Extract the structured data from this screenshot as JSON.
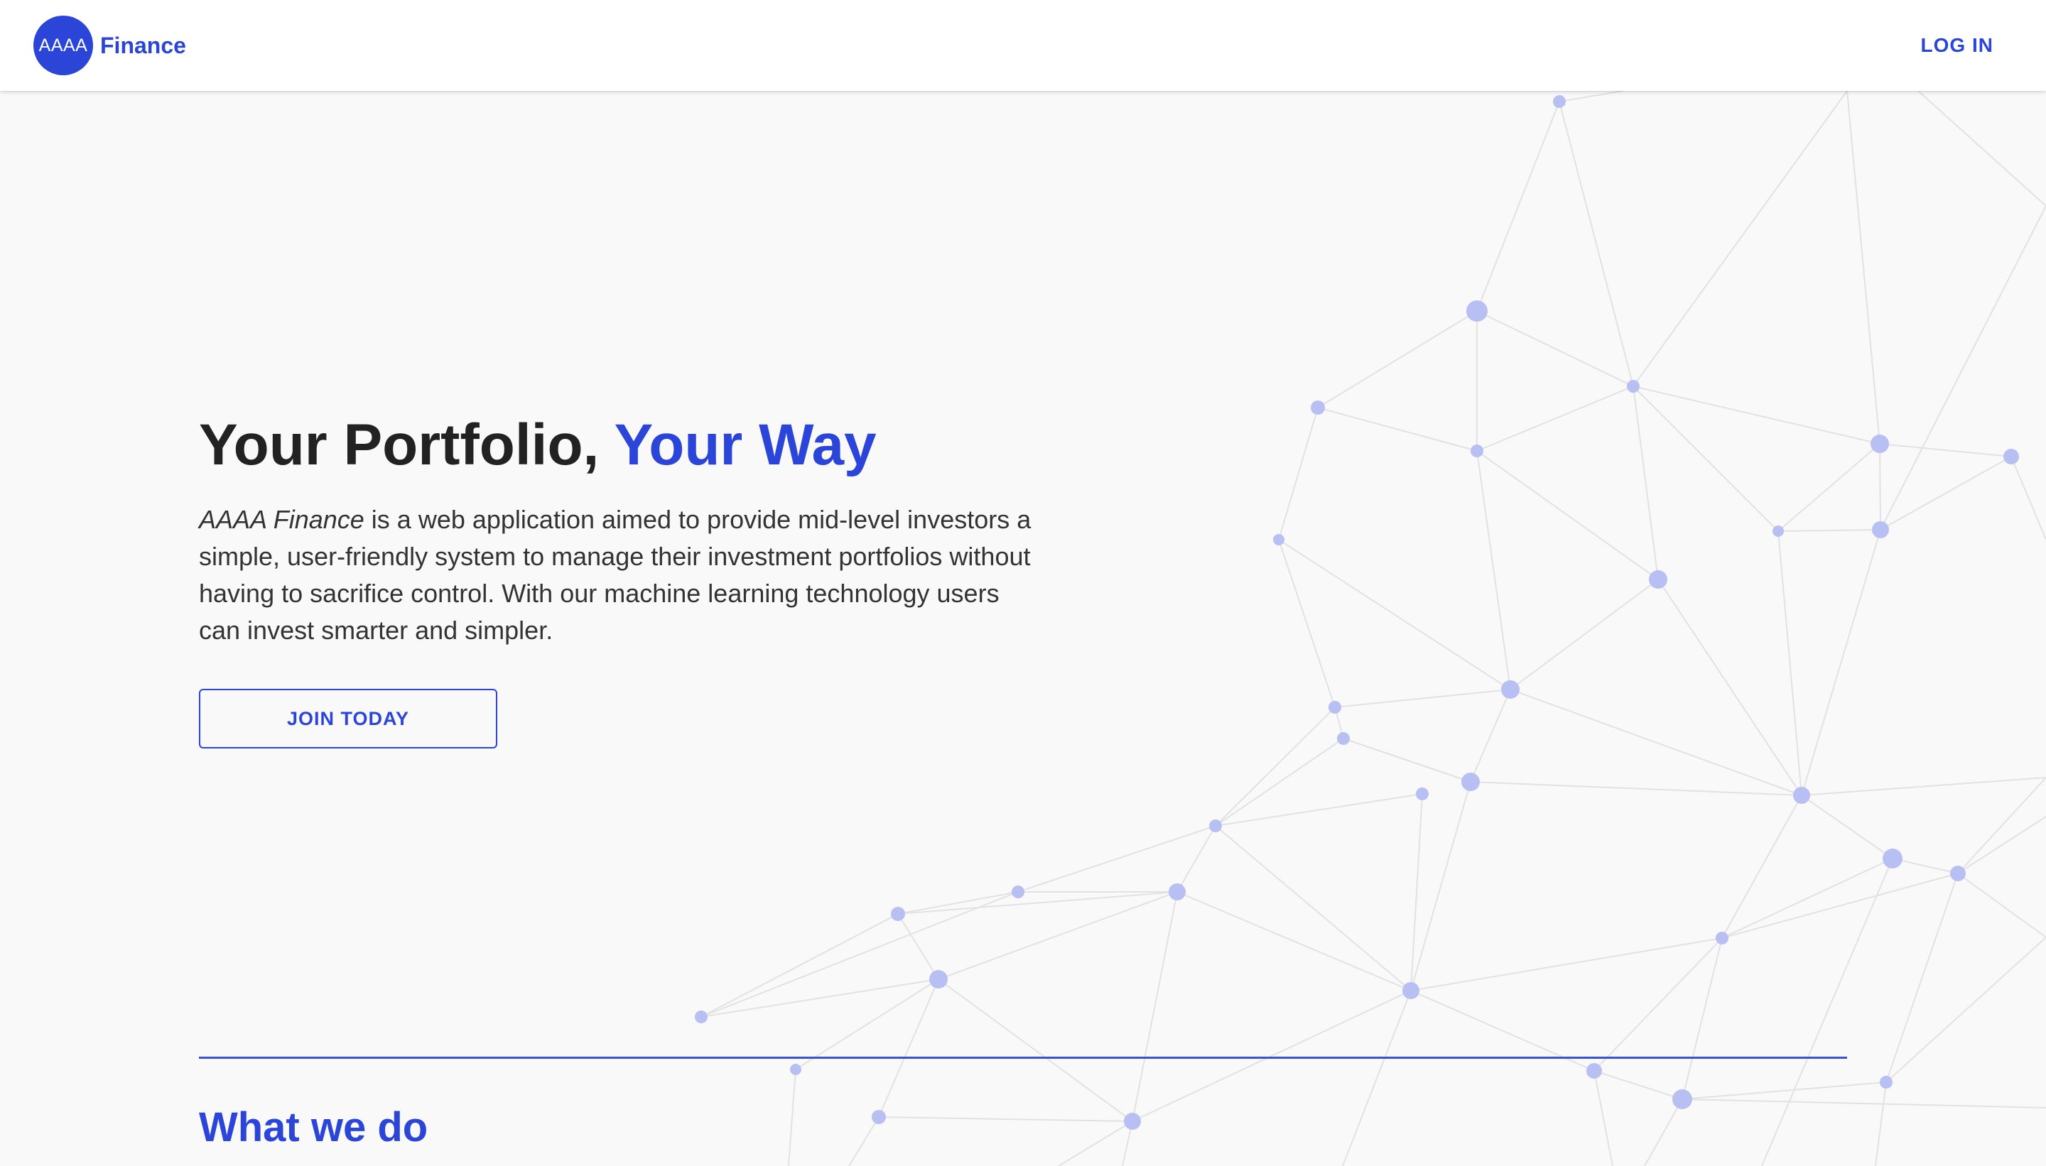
{
  "header": {
    "logo_text": "AAAA",
    "brand_name": "Finance",
    "login_label": "LOG IN"
  },
  "hero": {
    "title_part1": "Your Portfolio, ",
    "title_accent": "Your Way",
    "description_brand": "AAAA Finance",
    "description_text": " is a web application aimed to provide mid-level investors a simple, user-friendly system to manage their investment portfolios without having to sacrifice control. With our machine learning technology users can invest smarter and simpler.",
    "cta_label": "JOIN TODAY"
  },
  "section": {
    "title": "What we do"
  },
  "colors": {
    "accent": "#2b45d9",
    "background": "#f9f9f9",
    "node": "#b7bff2",
    "edge": "#e3e3e3"
  }
}
